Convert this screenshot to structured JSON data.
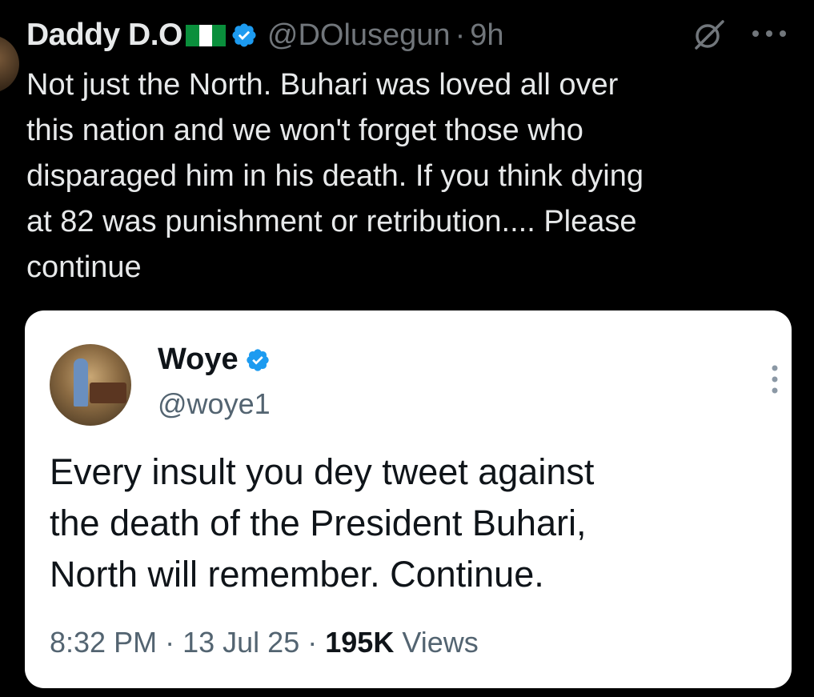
{
  "tweet": {
    "display_name": "Daddy D.O",
    "flag_icon": "nigeria-flag-icon",
    "handle": "@DOlusegun",
    "separator": "·",
    "time": "9h",
    "text": "Not just the North. Buhari was loved all over\nthis nation and we won't forget those who\ndisparaged him in his death. If you think dying\nat 82 was punishment or retribution.... Please\ncontinue",
    "icons": {
      "verified": "verified-badge-icon",
      "grok": "grok-icon",
      "more": "more-options-icon"
    }
  },
  "quoted": {
    "display_name": "Woye",
    "handle": "@woye1",
    "text": "Every insult you dey tweet against\nthe death of the President Buhari,\nNorth will remember. Continue.",
    "time": "8:32 PM",
    "date": "13 Jul 25",
    "views_count": "195K",
    "views_label": "Views",
    "separator": "·"
  },
  "colors": {
    "background": "#000000",
    "text_primary": "#e7e9ea",
    "text_secondary": "#71767b",
    "verified_blue": "#1d9bf0",
    "card_background": "#ffffff",
    "card_text": "#0f1419",
    "card_secondary": "#536471"
  }
}
